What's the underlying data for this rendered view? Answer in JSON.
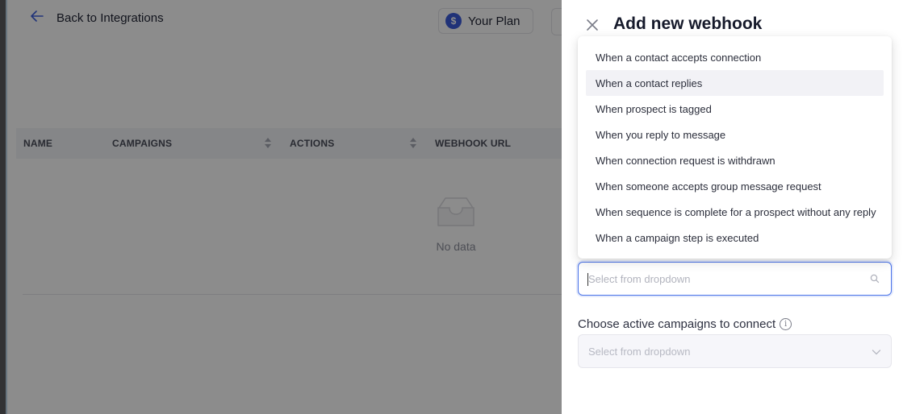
{
  "background": {
    "back_label": "Back to Integrations",
    "plan_label": "Your Plan",
    "plan_icon": "$",
    "table": {
      "columns": [
        "NAME",
        "CAMPAIGNS",
        "ACTIONS",
        "WEBHOOK URL"
      ]
    },
    "empty_text": "No data"
  },
  "drawer": {
    "title": "Add new webhook",
    "close_glyph": "✕",
    "trigger_select": {
      "placeholder": "Select from dropdown"
    },
    "campaigns": {
      "label": "Choose active campaigns to connect",
      "placeholder": "Select from dropdown",
      "info_glyph": "i"
    }
  },
  "dropdown": {
    "options": [
      "When a contact accepts connection",
      "When a contact replies",
      "When prospect is tagged",
      "When you reply to message",
      "When connection request is withdrawn",
      "When someone accepts group message request",
      "When sequence is complete for a prospect without any reply",
      "When a campaign step is executed"
    ],
    "hovered_index": 1
  },
  "colors": {
    "accent": "#3b5bdb",
    "focus_border": "#4a73e8"
  },
  "icons": [
    "arrow-left-icon",
    "dollar-icon",
    "sort-icon",
    "inbox-empty-icon",
    "close-icon",
    "search-icon",
    "info-icon",
    "chevron-down-icon"
  ]
}
